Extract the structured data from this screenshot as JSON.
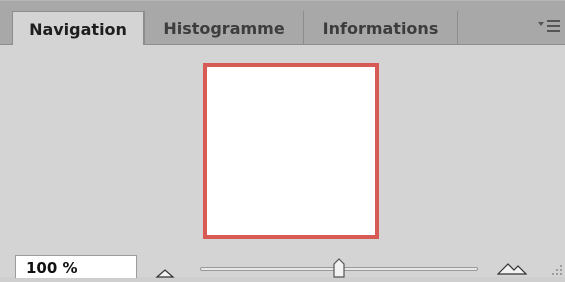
{
  "tabs": [
    {
      "label": "Navigation",
      "active": true
    },
    {
      "label": "Histogramme",
      "active": false
    },
    {
      "label": "Informations",
      "active": false
    }
  ],
  "panel_menu_icon": "panel-menu-icon",
  "preview": {
    "frame_color": "#d75a55",
    "background": "#ffffff"
  },
  "zoom": {
    "value": "100 %",
    "slider_fraction": 0.5,
    "zoom_out_icon": "small-mountain-icon",
    "zoom_in_icon": "large-mountain-icon"
  }
}
